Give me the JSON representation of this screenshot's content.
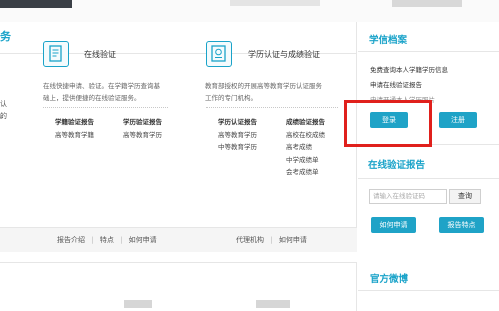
{
  "services": {
    "section_title_fragment": "务",
    "left_stub_lines": [
      "认的",
      "。"
    ],
    "online_verify": {
      "title": "在线验证",
      "desc_lines": [
        "在线快捷申请、验证。在学籍学历查询基",
        "础上，提供便捷的在线验证服务。"
      ],
      "col1": [
        "学籍验证报告",
        "高等教育学籍"
      ],
      "col2": [
        "学历验证报告",
        "高等教育学历"
      ]
    },
    "degree_cert": {
      "title": "学历认证与成绩验证",
      "desc_lines": [
        "教育部授权的开展高等教育学历认证服务",
        "工作的专门机构。"
      ],
      "col1": [
        "学历认证报告",
        "高等教育学历",
        "中等教育学历"
      ],
      "col2": [
        "成绩验证报告",
        "高校在校成绩",
        "高考成绩",
        "中学成绩单",
        "会考成绩单"
      ]
    },
    "footer_left": [
      "报告介绍",
      "|",
      "特点",
      "|",
      "如何申请"
    ],
    "footer_right": [
      "代理机构",
      "|",
      "如何申请"
    ]
  },
  "sidebar": {
    "archive_title": "学信档案",
    "links": [
      "免费查询本人学籍学历信息",
      "申请在线验证报告",
      "申请开通本人学历照片"
    ],
    "login_label": "登录",
    "register_label": "注册",
    "verify_title": "在线验证报告",
    "verify_placeholder": "请输入在线验证码",
    "query_label": "查询",
    "how_apply_label": "如何申请",
    "report_features_label": "报告特点",
    "weibo_title": "官方微博"
  }
}
